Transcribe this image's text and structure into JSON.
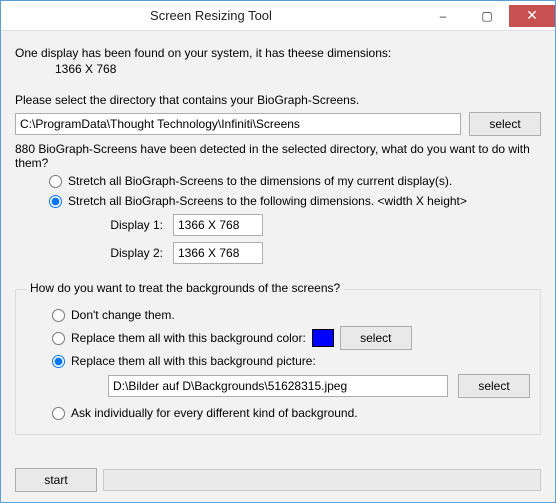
{
  "window": {
    "title": "Screen Resizing Tool",
    "buttons": {
      "min": "–",
      "max": "▢",
      "close": "✕"
    }
  },
  "intro": {
    "line1": "One display has been found on your system, it has theese dimensions:",
    "dims": "1366 X 768"
  },
  "dir": {
    "prompt": "Please select the directory that contains your BioGraph-Screens.",
    "value": "C:\\ProgramData\\Thought Technology\\Infiniti\\Screens",
    "select": "select"
  },
  "detect": {
    "line": "880 BioGraph-Screens have been detected in the selected directory, what do you want to do with them?"
  },
  "stretch": {
    "opt_current": "Stretch all BioGraph-Screens to the dimensions of my current display(s).",
    "opt_custom": "Stretch all BioGraph-Screens to the following dimensions.  <width X height>",
    "display1_label": "Display 1:",
    "display1_value": "1366 X 768",
    "display2_label": "Display 2:",
    "display2_value": "1366 X 768"
  },
  "bg": {
    "group_label": "How do you want to treat the backgrounds of the screens?",
    "opt_none": "Don't change them.",
    "opt_color": "Replace them all with this background color:",
    "color_select": "select",
    "color_hex": "#0000ff",
    "opt_picture": "Replace them all with this background picture:",
    "picture_path": "D:\\Bilder auf D\\Backgrounds\\51628315.jpeg",
    "picture_select": "select",
    "opt_ask": "Ask individually for every different kind of background."
  },
  "footer": {
    "start": "start"
  }
}
